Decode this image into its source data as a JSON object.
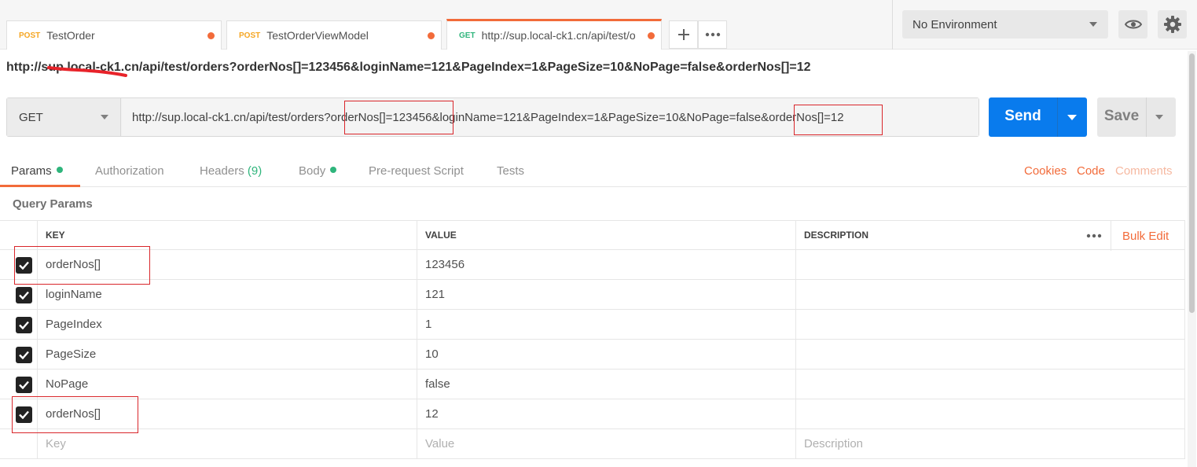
{
  "tabs": [
    {
      "method": "POST",
      "title": "TestOrder"
    },
    {
      "method": "POST",
      "title": "TestOrderViewModel"
    },
    {
      "method": "GET",
      "title": "http://sup.local-ck1.cn/api/test/o"
    }
  ],
  "environment": {
    "selected": "No Environment"
  },
  "request": {
    "title_url": "http://sup.local-ck1.cn/api/test/orders?orderNos[]=123456&loginName=121&PageIndex=1&PageSize=10&NoPage=false&orderNos[]=12",
    "method": "GET",
    "url_part1": "http://sup.local-ck1.cn/api/test/orders?",
    "url_part2": "orderNos[]=123456",
    "url_part3": "&loginName=121&PageIndex=1&PageSize=10&NoPage=false&",
    "url_part4": "orderNos[]=12"
  },
  "buttons": {
    "send": "Send",
    "save": "Save"
  },
  "request_tabs": {
    "params": "Params",
    "authorization": "Authorization",
    "headers": "Headers",
    "headers_count": "(9)",
    "body": "Body",
    "prerequest": "Pre-request Script",
    "tests": "Tests"
  },
  "links": {
    "cookies": "Cookies",
    "code": "Code",
    "comments": "Comments",
    "bulk_edit": "Bulk Edit"
  },
  "query_params": {
    "title": "Query Params",
    "headers": {
      "key": "KEY",
      "value": "VALUE",
      "description": "DESCRIPTION"
    },
    "rows": [
      {
        "key": "orderNos[]",
        "value": "123456",
        "description": ""
      },
      {
        "key": "loginName",
        "value": "121",
        "description": ""
      },
      {
        "key": "PageIndex",
        "value": "1",
        "description": ""
      },
      {
        "key": "PageSize",
        "value": "10",
        "description": ""
      },
      {
        "key": "NoPage",
        "value": "false",
        "description": ""
      },
      {
        "key": "orderNos[]",
        "value": "12",
        "description": ""
      }
    ],
    "placeholders": {
      "key": "Key",
      "value": "Value",
      "description": "Description"
    }
  },
  "colors": {
    "accent": "#f26b3a",
    "send": "#097bed",
    "green": "#2fb57c",
    "annotation": "#d9262b"
  }
}
